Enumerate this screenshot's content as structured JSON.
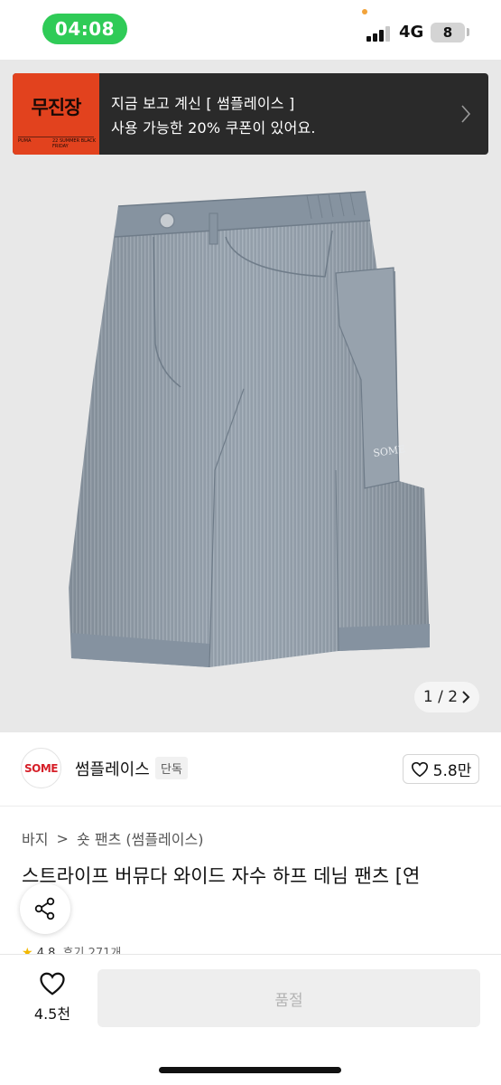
{
  "status_bar": {
    "time": "04:08",
    "network": "4G",
    "battery": "8"
  },
  "banner": {
    "logo_title": "무진장",
    "logo_small_left": "PUMA",
    "logo_small_right": "22 SUMMER BLACK FRIDAY",
    "line1": "지금 보고 계신 [ 썸플레이스 ]",
    "line2": "사용 가능한 20% 쿠폰이 있어요."
  },
  "gallery": {
    "pager_text": "1 / 2",
    "embroidery": "SOME"
  },
  "seller": {
    "logo_text": "SOME",
    "name": "썸플레이스",
    "badge": "단독",
    "like_count": "5.8만"
  },
  "breadcrumb": {
    "category": "바지",
    "separator": ">",
    "subcategory": "숏 팬츠 (썸플레이스)"
  },
  "product": {
    "title": "스트라이프 버뮤다 와이드 자수 하프 데님 팬츠 [연",
    "rating": "4.8",
    "review_text": "후기 271개"
  },
  "bottom_bar": {
    "wish_count": "4.5천",
    "buy_label": "품절"
  },
  "colors": {
    "status_green": "#2fcb57",
    "banner_bg": "#2a2a2a",
    "banner_logo": "#e2421e",
    "seller_red": "#d62029",
    "star": "#f2b800"
  }
}
